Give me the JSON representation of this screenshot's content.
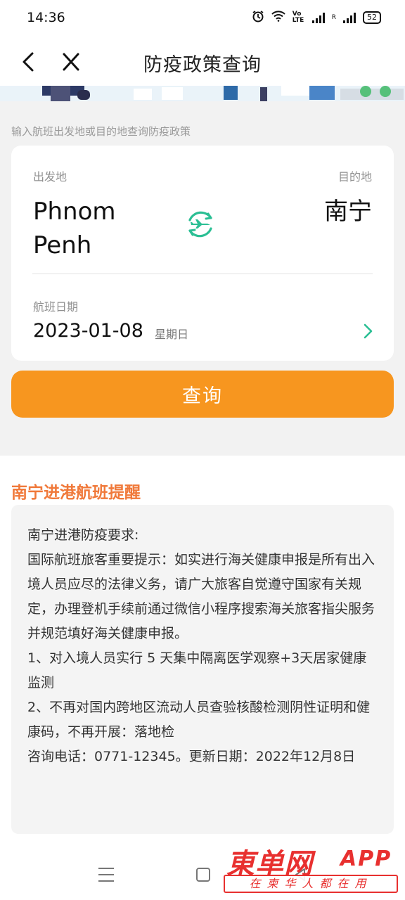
{
  "status_bar": {
    "time": "14:36",
    "network_label": "Vo LTE",
    "roaming": "R",
    "battery": "52"
  },
  "nav": {
    "title": "防疫政策查询"
  },
  "hint": "输入航班出发地或目的地查询防疫政策",
  "route": {
    "from_label": "出发地",
    "from_city": "Phnom Penh",
    "to_label": "目的地",
    "to_city": "南宁",
    "date_label": "航班日期",
    "date_value": "2023-01-08",
    "weekday": "星期日"
  },
  "query_button": "查询",
  "reminder": {
    "title": "南宁进港航班提醒",
    "lines": [
      "南宁进港防疫要求:",
      "国际航班旅客重要提示：如实进行海关健康申报是所有出入境人员应尽的法律义务，请广大旅客自觉遵守国家有关规定，办理登机手续前通过微信小程序搜索海关旅客指尖服务并规范填好海关健康申报。",
      "1、对入境人员实行 5 天集中隔离医学观察+3天居家健康监测",
      "2、不再对国内跨地区流动人员查验核酸检测阴性证明和健康码，不再开展：落地检",
      "咨询电话：0771-12345。更新日期：2022年12月8日"
    ]
  },
  "watermark": {
    "logo": "東单网",
    "app": "APP",
    "slogan": "在柬华人都在用"
  },
  "colors": {
    "accent_orange": "#f7961f",
    "reminder_title": "#f0793a",
    "icon_green": "#2bbf94",
    "watermark_red": "#e8302f"
  },
  "icons": [
    "back-icon",
    "close-icon",
    "plane-swap-icon",
    "chevron-right-icon",
    "menu-icon",
    "home-icon",
    "back-triangle-icon"
  ]
}
